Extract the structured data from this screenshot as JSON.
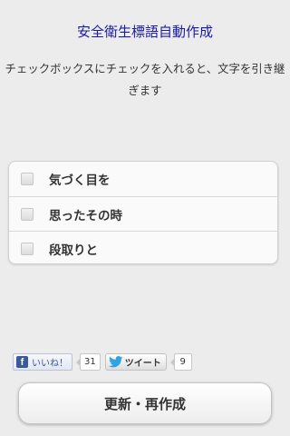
{
  "header": {
    "title": "安全衛生標語自動作成",
    "description": "チェックボックスにチェックを入れると、文字を引き継ぎます"
  },
  "checklist": {
    "items": [
      {
        "label": "気づく目を",
        "checked": false
      },
      {
        "label": "思ったその時",
        "checked": false
      },
      {
        "label": "段取りと",
        "checked": false
      }
    ]
  },
  "social": {
    "like_label": "いいね！",
    "like_count": "31",
    "tweet_label": "ツイート",
    "tweet_count": "9",
    "facebook_color": "#3b5998",
    "twitter_color": "#2fa4de"
  },
  "action": {
    "regenerate_label": "更新・再作成"
  },
  "colors": {
    "title": "#1a1aa6",
    "background": "#ececed"
  }
}
